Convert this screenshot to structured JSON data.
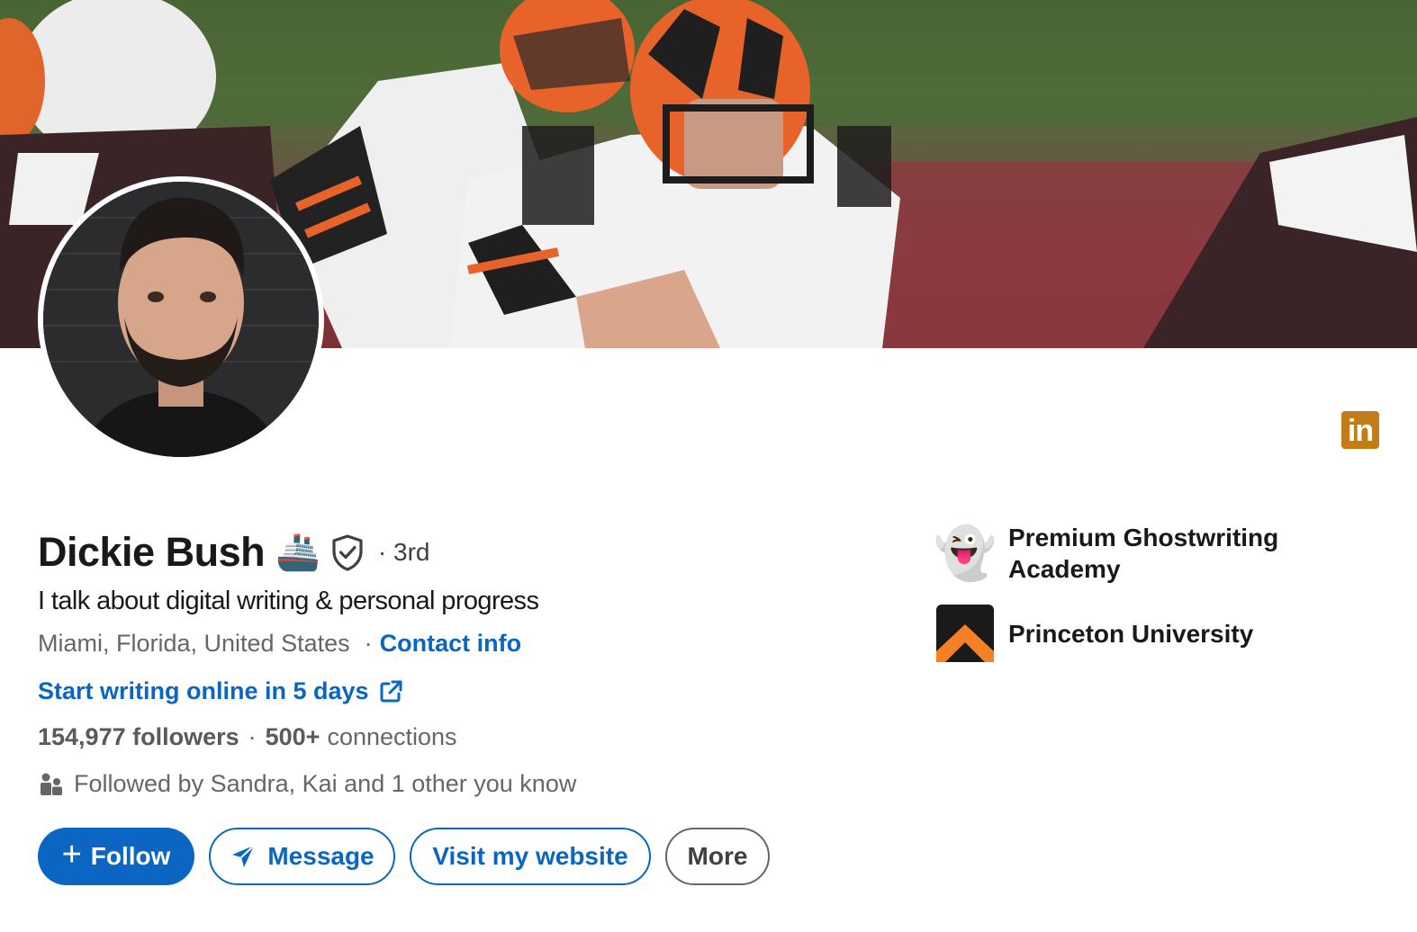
{
  "profile": {
    "name": "Dickie Bush",
    "name_emoji": "🚢",
    "degree": "· 3rd",
    "headline": "I talk about digital writing & personal progress",
    "location": "Miami, Florida, United States",
    "location_separator": "·",
    "contact_info_label": "Contact info",
    "website_link_label": "Start writing online in 5 days",
    "followers": "154,977 followers",
    "stats_separator": "·",
    "connections_count": "500+",
    "connections_label": "connections",
    "followed_by": "Followed by Sandra, Kai and 1 other you know"
  },
  "actions": {
    "follow_plus": "+",
    "follow_label": "Follow",
    "message_label": "Message",
    "website_label": "Visit my website",
    "more_label": "More"
  },
  "organizations": [
    {
      "icon": "ghost-emoji",
      "glyph": "👻",
      "label_line1": "Premium Ghostwriting",
      "label_line2": "Academy"
    },
    {
      "icon": "princeton-logo",
      "label_line1": "Princeton University"
    }
  ],
  "badge": {
    "icon": "linkedin-icon",
    "text": "in"
  },
  "colors": {
    "primary_blue": "#0a66c2",
    "badge_gold": "#c37d16",
    "muted_text": "#666666",
    "princeton_orange": "#f58025"
  }
}
